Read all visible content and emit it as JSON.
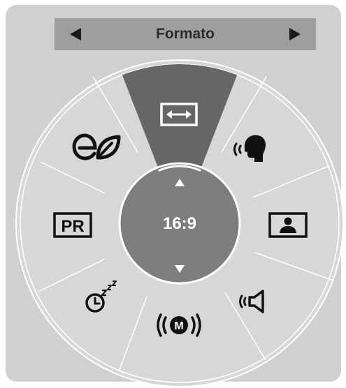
{
  "header": {
    "title": "Formato",
    "prev_icon": "triangle-left-icon",
    "next_icon": "triangle-right-icon"
  },
  "center": {
    "value": "16:9",
    "up_icon": "triangle-up-icon",
    "down_icon": "triangle-down-icon"
  },
  "menu_items": [
    {
      "name": "aspect-ratio",
      "icon": "double-arrow-icon",
      "selected": true
    },
    {
      "name": "sound-voice",
      "icon": "speaking-head-icon"
    },
    {
      "name": "picture",
      "icon": "person-picture-icon"
    },
    {
      "name": "sound-mode",
      "icon": "speaker-icon"
    },
    {
      "name": "multi-audio",
      "icon": "m-broadcast-icon"
    },
    {
      "name": "sleep-timer",
      "icon": "clock-zzz-icon"
    },
    {
      "name": "program",
      "icon": "pr-box-icon",
      "label": "PR"
    },
    {
      "name": "energy-saving",
      "icon": "eco-leaf-icon"
    }
  ],
  "colors": {
    "panel": "#d0d0d0",
    "header": "#9e9e9e",
    "dial": "#d7d7d7",
    "center": "#7e7e7e",
    "selected_sector": "#666666",
    "icon": "#111111"
  }
}
